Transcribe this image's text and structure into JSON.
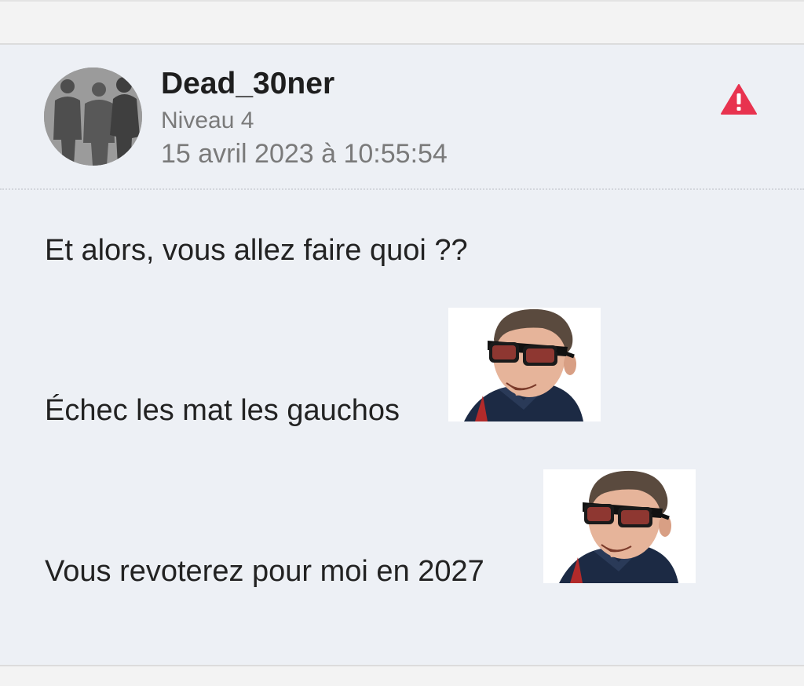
{
  "post": {
    "author": {
      "username": "Dead_30ner",
      "level": "Niveau 4",
      "avatar_icon": "group-silhouette-avatar"
    },
    "timestamp": "15 avril 2023 à 10:55:54",
    "report_icon": "warning-triangle-icon",
    "report_color": "#e8334f",
    "body": {
      "line1": "Et alors, vous allez faire quoi ??",
      "line2": "Échec les mat les gauchos",
      "line3": "Vous revoterez pour moi en 2027"
    },
    "stickers": [
      {
        "name": "sunglasses-man-sticker"
      },
      {
        "name": "sunglasses-man-sticker"
      }
    ]
  }
}
